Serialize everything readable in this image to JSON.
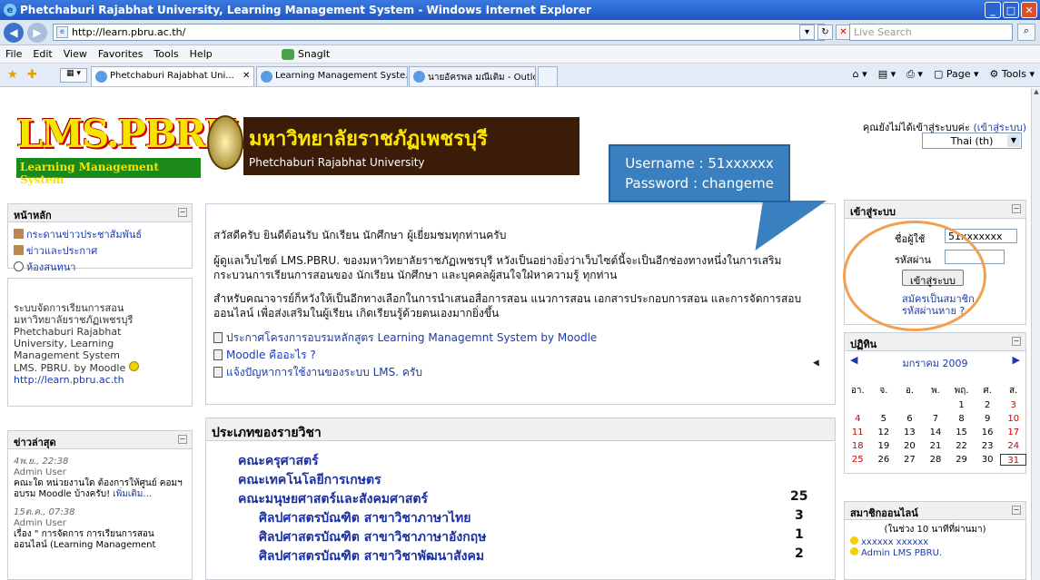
{
  "window": {
    "title": "Phetchaburi Rajabhat University, Learning Management System - Windows Internet Explorer"
  },
  "address": {
    "url": "http://learn.pbru.ac.th/",
    "search_placeholder": "Live Search"
  },
  "menu": {
    "items": [
      "File",
      "Edit",
      "View",
      "Favorites",
      "Tools",
      "Help"
    ],
    "snagit": "SnagIt"
  },
  "tabs": [
    {
      "label": "Phetchaburi Rajabhat Uni..."
    },
    {
      "label": "Learning Management Syste..."
    },
    {
      "label": "นายอัครพล มณีเติม - Outlook ..."
    }
  ],
  "toolbar": {
    "page": "Page",
    "tools": "Tools"
  },
  "header": {
    "logo_main": "LMS.PBRU.",
    "logo_sub": "Learning Management System",
    "banner_th": "มหาวิทยาลัยราชภัฏเพชรบุรี",
    "banner_en": "Phetchaburi Rajabhat University",
    "login_status": "คุณยังไม่ได้เข้าสู่ระบบค่ะ",
    "login_link": "(เข้าสู่ระบบ)",
    "language": "Thai (th)"
  },
  "callout": {
    "line1": "Username : 51xxxxxx",
    "line2": "Password : changeme"
  },
  "left": {
    "main_menu": {
      "title": "หน้าหลัก",
      "items": [
        "กระดานข่าวประชาสัมพันธ์",
        "ข่าวและประกาศ",
        "ห้องสนทนา"
      ]
    },
    "about": {
      "lines": [
        "ระบบจัดการเรียนการสอน",
        "มหาวิทยาลัยราชภัฏเพชรบุรี",
        "Phetchaburi Rajabhat",
        "University, Learning",
        "Management System",
        "LMS. PBRU. by Moodle",
        "http://learn.pbru.ac.th"
      ]
    },
    "news": {
      "title": "ข่าวล่าสุด",
      "items": [
        {
          "date": "4พ.ย., 22:38",
          "author": "Admin User",
          "text": "คณะใด หน่วยงานใด ต้องการให้ศูนย์ คอมฯ อบรม Moodle บ้างครับ!",
          "more": "เพิ่มเติม..."
        },
        {
          "date": "15ต.ค., 07:38",
          "author": "Admin User",
          "text": "เรื่อง \" การจัดการ การเรียนการสอนออนไลน์ (Learning Management"
        }
      ]
    }
  },
  "main": {
    "welcome": "สวัสดีครับ ยินดีต้อนรับ นักเรียน นักศึกษา ผู้เยี่ยมชมทุกท่านครับ",
    "para1": "ผู้ดูแลเว็บไซต์ LMS.PBRU. ของมหาวิทยาลัยราชภัฏเพชรบุรี หวังเป็นอย่างยิ่งว่าเว็บไซต์นี้จะเป็นอีกช่องทางหนึ่งในการเสริมกระบวนการเรียนการสอนของ นักเรียน นักศึกษา และบุคคลผู้สนใจใฝ่หาความรู้ ทุกท่าน",
    "para2": "สำหรับคณาจารย์ก็หวังให้เป็นอีกทางเลือกในการนำเสนอสื่อการสอน แนวการสอน เอกสารประกอบการสอน และการจัดการสอบออนไลน์ เพื่อส่งเสริมในผู้เรียน เกิดเรียนรู้ด้วยตนเองมากยิ่งขึ้น",
    "resources": [
      "ประกาศโครงการอบรมหลักสูตร Learning Managemnt System by Moodle",
      "Moodle คืออะไร ?",
      "แจ้งปัญหาการใช้งานของระบบ LMS. ครับ"
    ],
    "categories_title": "ประเภทของรายวิชา",
    "categories": [
      {
        "name": "คณะครุศาสตร์",
        "count": ""
      },
      {
        "name": "คณะเทคโนโลยีการเกษตร",
        "count": ""
      },
      {
        "name": "คณะมนุษยศาสตร์และสังคมศาสตร์",
        "count": "25"
      },
      {
        "name": "ศิลปศาสตรบัณฑิต สาขาวิชาภาษาไทย",
        "count": "3"
      },
      {
        "name": "ศิลปศาสตรบัณฑิต สาขาวิชาภาษาอังกฤษ",
        "count": "1"
      },
      {
        "name": "ศิลปศาสตรบัณฑิต สาขาวิชาพัฒนาสังคม",
        "count": "2"
      }
    ]
  },
  "right": {
    "login": {
      "title": "เข้าสู่ระบบ",
      "user_label": "ชื่อผู้ใช้",
      "user_value": "51xxxxxxx",
      "pass_label": "รหัสผ่าน",
      "button": "เข้าสู่ระบบ",
      "signup": "สมัครเป็นสมาชิก",
      "forgot": "รหัสผ่านหาย ?"
    },
    "calendar": {
      "title": "ปฏิทิน",
      "month": "มกราคม 2009",
      "weekdays": [
        "อา.",
        "จ.",
        "อ.",
        "พ.",
        "พฤ.",
        "ศ.",
        "ส."
      ],
      "days": [
        "",
        "",
        "",
        "",
        "1",
        "2",
        "3",
        "4",
        "5",
        "6",
        "7",
        "8",
        "9",
        "10",
        "11",
        "12",
        "13",
        "14",
        "15",
        "16",
        "17",
        "18",
        "19",
        "20",
        "21",
        "22",
        "23",
        "24",
        "25",
        "26",
        "27",
        "28",
        "29",
        "30",
        "31"
      ]
    },
    "online": {
      "title": "สมาชิกออนไลน์",
      "period": "(ในช่วง 10 นาทีที่ผ่านมา)",
      "users": [
        "xxxxxx xxxxxx",
        "Admin LMS PBRU."
      ]
    }
  }
}
